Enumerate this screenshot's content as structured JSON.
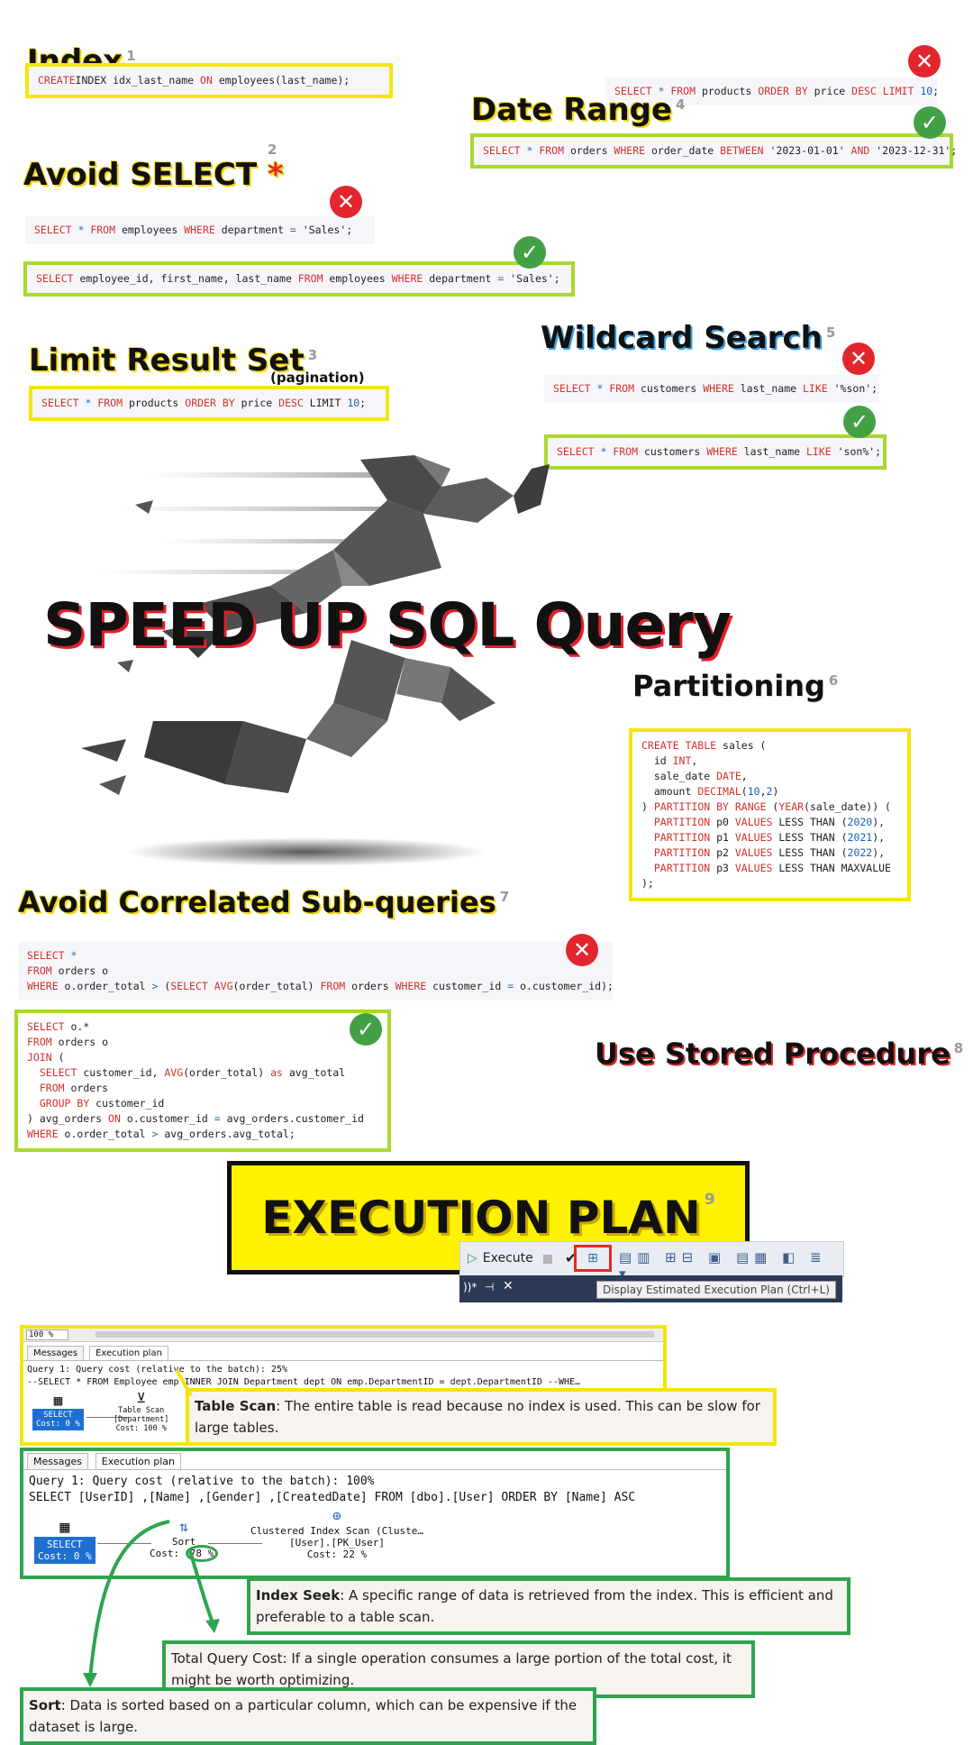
{
  "index": {
    "title": "Index",
    "num": "1",
    "code": [
      [
        "kw",
        "CREATE"
      ],
      [
        "",
        "INDEX idx_last_name "
      ],
      [
        "kw",
        "ON"
      ],
      [
        "",
        " employees(last_name);"
      ]
    ]
  },
  "top_bad": {
    "code": [
      [
        "kw",
        "SELECT"
      ],
      [
        "op",
        " * "
      ],
      [
        "kw",
        "FROM"
      ],
      [
        "",
        " products "
      ],
      [
        "kw",
        "ORDER BY"
      ],
      [
        "",
        " price "
      ],
      [
        "kw",
        "DESC LIMIT"
      ],
      [
        "n",
        " 10"
      ],
      [
        "",
        ";"
      ]
    ]
  },
  "date_range": {
    "title": "Date Range",
    "num": "4",
    "code": [
      [
        "kw",
        "SELECT"
      ],
      [
        "op",
        " * "
      ],
      [
        "kw",
        "FROM"
      ],
      [
        "",
        " orders "
      ],
      [
        "kw",
        "WHERE"
      ],
      [
        "",
        " order_date "
      ],
      [
        "kw",
        "BETWEEN"
      ],
      [
        "",
        " '2023-01-01' "
      ],
      [
        "kw",
        "AND"
      ],
      [
        "",
        " '2023-12-31';"
      ]
    ]
  },
  "avoid_select": {
    "title": "Avoid SELECT",
    "star": "*",
    "num": "2",
    "bad": [
      [
        "kw",
        "SELECT"
      ],
      [
        "op",
        " * "
      ],
      [
        "kw",
        "FROM"
      ],
      [
        "",
        " employees "
      ],
      [
        "kw",
        "WHERE"
      ],
      [
        "",
        " department "
      ],
      [
        "op",
        "="
      ],
      [
        "",
        " 'Sales';"
      ]
    ],
    "good": [
      [
        "kw",
        "SELECT"
      ],
      [
        "",
        " employee_id, first_name, last_name "
      ],
      [
        "kw",
        "FROM"
      ],
      [
        "",
        " employees "
      ],
      [
        "kw",
        "WHERE"
      ],
      [
        "",
        " department "
      ],
      [
        "op",
        "="
      ],
      [
        "",
        " 'Sales';"
      ]
    ]
  },
  "limit": {
    "title": "Limit Result Set",
    "num": "3",
    "sub": "(pagination)",
    "code": [
      [
        "kw",
        "SELECT"
      ],
      [
        "op",
        " * "
      ],
      [
        "kw",
        "FROM"
      ],
      [
        "",
        " products "
      ],
      [
        "kw",
        "ORDER BY"
      ],
      [
        "",
        " price "
      ],
      [
        "kw",
        "DESC"
      ],
      [
        "",
        " LIMIT "
      ],
      [
        "n",
        "10"
      ],
      [
        "",
        ";"
      ]
    ]
  },
  "wildcard": {
    "title": "Wildcard Search",
    "num": "5",
    "bad": [
      [
        "kw",
        "SELECT"
      ],
      [
        "op",
        " * "
      ],
      [
        "kw",
        "FROM"
      ],
      [
        "",
        " customers "
      ],
      [
        "kw",
        "WHERE"
      ],
      [
        "",
        " last_name "
      ],
      [
        "kw",
        "LIKE"
      ],
      [
        "",
        " '%son';"
      ]
    ],
    "good": [
      [
        "kw",
        "SELECT"
      ],
      [
        "op",
        " * "
      ],
      [
        "kw",
        "FROM"
      ],
      [
        "",
        " customers "
      ],
      [
        "kw",
        "WHERE"
      ],
      [
        "",
        " last_name "
      ],
      [
        "kw",
        "LIKE"
      ],
      [
        "",
        " 'son%';"
      ]
    ]
  },
  "headline": "SPEED UP SQL Query",
  "partitioning": {
    "title": "Partitioning",
    "num": "6",
    "lines": [
      [
        [
          "kw",
          "CREATE TABLE"
        ],
        [
          "",
          " sales ("
        ]
      ],
      [
        [
          "",
          "  id "
        ],
        [
          "kw",
          "INT"
        ],
        [
          "",
          ","
        ]
      ],
      [
        [
          "",
          "  sale_date "
        ],
        [
          "kw",
          "DATE"
        ],
        [
          "",
          ","
        ]
      ],
      [
        [
          "",
          "  amount "
        ],
        [
          "kw",
          "DECIMAL"
        ],
        [
          "",
          "("
        ],
        [
          "n",
          "10"
        ],
        [
          "",
          ","
        ],
        [
          "n",
          "2"
        ],
        [
          "",
          ")"
        ]
      ],
      [
        [
          "",
          ") "
        ],
        [
          "kw",
          "PARTITION BY RANGE"
        ],
        [
          "",
          " ("
        ],
        [
          "kw",
          "YEAR"
        ],
        [
          "",
          "(sale_date)) ("
        ]
      ],
      [
        [
          "",
          "  "
        ],
        [
          "kw",
          "PARTITION"
        ],
        [
          "",
          " p0 "
        ],
        [
          "kw",
          "VALUES"
        ],
        [
          "",
          " LESS THAN ("
        ],
        [
          "n",
          "2020"
        ],
        [
          "",
          "),"
        ]
      ],
      [
        [
          "",
          "  "
        ],
        [
          "kw",
          "PARTITION"
        ],
        [
          "",
          " p1 "
        ],
        [
          "kw",
          "VALUES"
        ],
        [
          "",
          " LESS THAN ("
        ],
        [
          "n",
          "2021"
        ],
        [
          "",
          "),"
        ]
      ],
      [
        [
          "",
          "  "
        ],
        [
          "kw",
          "PARTITION"
        ],
        [
          "",
          " p2 "
        ],
        [
          "kw",
          "VALUES"
        ],
        [
          "",
          " LESS THAN ("
        ],
        [
          "n",
          "2022"
        ],
        [
          "",
          "),"
        ]
      ],
      [
        [
          "",
          "  "
        ],
        [
          "kw",
          "PARTITION"
        ],
        [
          "",
          " p3 "
        ],
        [
          "kw",
          "VALUES"
        ],
        [
          "",
          " LESS THAN MAXVALUE"
        ]
      ],
      [
        [
          "",
          ");"
        ]
      ]
    ]
  },
  "correlated": {
    "title": "Avoid Correlated Sub-queries",
    "num": "7",
    "bad": [
      [
        [
          "kw",
          "SELECT"
        ],
        [
          "op",
          " *"
        ]
      ],
      [
        [
          "kw",
          "FROM"
        ],
        [
          "",
          " orders o"
        ]
      ],
      [
        [
          "kw",
          "WHERE"
        ],
        [
          "",
          " o.order_total "
        ],
        [
          "op",
          ">"
        ],
        [
          "",
          " ("
        ],
        [
          "kw",
          "SELECT AVG"
        ],
        [
          "",
          "(order_total) "
        ],
        [
          "kw",
          "FROM"
        ],
        [
          "",
          " orders "
        ],
        [
          "kw",
          "WHERE"
        ],
        [
          "",
          " customer_id "
        ],
        [
          "op",
          "="
        ],
        [
          "",
          " o.customer_id);"
        ]
      ]
    ],
    "good": [
      [
        [
          "kw",
          "SELECT"
        ],
        [
          "",
          " o.*"
        ]
      ],
      [
        [
          "kw",
          "FROM"
        ],
        [
          "",
          " orders o"
        ]
      ],
      [
        [
          "kw",
          "JOIN"
        ],
        [
          "",
          " ("
        ]
      ],
      [
        [
          "",
          "  "
        ],
        [
          "kw",
          "SELECT"
        ],
        [
          "",
          " customer_id, "
        ],
        [
          "kw",
          "AVG"
        ],
        [
          "",
          "(order_total) "
        ],
        [
          "kw",
          "as"
        ],
        [
          "",
          " avg_total"
        ]
      ],
      [
        [
          "",
          "  "
        ],
        [
          "kw",
          "FROM"
        ],
        [
          "",
          " orders"
        ]
      ],
      [
        [
          "",
          "  "
        ],
        [
          "kw",
          "GROUP BY"
        ],
        [
          "",
          " customer_id"
        ]
      ],
      [
        [
          "",
          ") avg_orders "
        ],
        [
          "kw",
          "ON"
        ],
        [
          "",
          " o.customer_id "
        ],
        [
          "op",
          "="
        ],
        [
          "",
          " avg_orders.customer_id"
        ]
      ],
      [
        [
          "kw",
          "WHERE"
        ],
        [
          "",
          " o.order_total "
        ],
        [
          "op",
          ">"
        ],
        [
          "",
          " avg_orders.avg_total;"
        ]
      ]
    ]
  },
  "stored": {
    "title": "Use Stored Procedure",
    "num": "8"
  },
  "execution": {
    "title": "EXECUTION PLAN",
    "num": "9",
    "execute_label": "Execute",
    "tab_label": "))*",
    "tooltip": "Display Estimated Execution Plan (Ctrl+L)"
  },
  "plan1": {
    "zoom": "100 %",
    "tab_messages": "Messages",
    "tab_plan": "Execution plan",
    "line1": "Query 1: Query cost (relative to the batch): 25%",
    "line2": "--SELECT * FROM Employee emp INNER JOIN Department dept ON emp.DepartmentID = dept.DepartmentID --WHE…",
    "select_label": "SELECT",
    "select_cost": "Cost: 0 %",
    "scan_label": "Table Scan",
    "scan_obj": "[Department]",
    "scan_cost": "Cost: 100 %"
  },
  "table_scan_desc": {
    "term": "Table Scan",
    "text": ": The entire table is read because no index is used. This can be slow for large tables."
  },
  "plan2": {
    "tab_messages": "Messages",
    "tab_plan": "Execution plan",
    "line1": "Query 1: Query cost (relative to the batch): 100%",
    "line2": "SELECT [UserID] ,[Name] ,[Gender] ,[CreatedDate] FROM [dbo].[User] ORDER BY [Name] ASC",
    "select_label": "SELECT",
    "select_cost": "Cost: 0 %",
    "sort_label": "Sort",
    "sort_cost_prefix": "Cost:",
    "sort_cost": "78 %",
    "clustered_label": "Clustered Index Scan (Cluste…",
    "clustered_obj": "[User].[PK_User]",
    "clustered_cost": "Cost: 22 %"
  },
  "index_seek_desc": {
    "term": "Index Seek",
    "text": ": A specific range of data is retrieved from the index. This is efficient and preferable to a table scan."
  },
  "total_cost_desc": {
    "text": "Total Query Cost: If a single operation consumes a large portion of the total cost, it might be worth optimizing."
  },
  "sort_desc": {
    "term": "Sort",
    "text": ": Data is sorted based on a particular column, which can be expensive if the dataset is large."
  },
  "colors": {
    "yellow": "#f2e60e",
    "lime": "#a8d830",
    "green": "#2fa44f",
    "red": "#e3262e",
    "keyword": "#d2322d"
  }
}
